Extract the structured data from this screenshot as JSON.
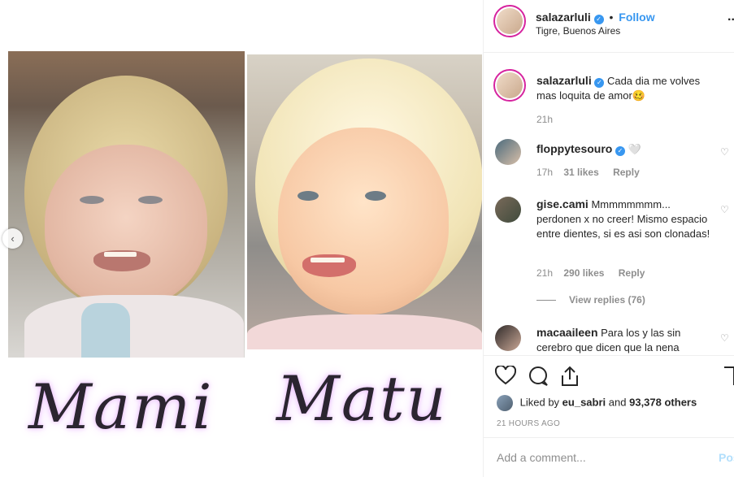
{
  "media": {
    "left_label": "Mami",
    "right_label": "Matu"
  },
  "header": {
    "username": "salazarluli",
    "separator": "•",
    "follow_label": "Follow",
    "location": "Tigre, Buenos Aires",
    "more_icon": "more-horizontal-icon",
    "more_glyph": "..."
  },
  "caption": {
    "username": "salazarluli",
    "text": "Cada dia me volves mas loquita de amor🥴",
    "time": "21h"
  },
  "comments": [
    {
      "username": "floppytesouro",
      "verified": true,
      "text": "🤍",
      "time": "17h",
      "likes": "31 likes",
      "reply_label": "Reply"
    },
    {
      "username": "gise.cami",
      "verified": false,
      "text": "Mmmmmmmm... perdonen x no creer! Mismo espacio entre dientes, si es asi son clonadas!",
      "time": "21h",
      "likes": "290 likes",
      "reply_label": "Reply",
      "view_replies": "View replies (76)"
    },
    {
      "username": "macaaileen",
      "verified": false,
      "text": "Para los y las sin cerebro que dicen que la nena"
    }
  ],
  "actions": {
    "liked_prefix": "Liked by",
    "liked_user": "eu_sabri",
    "liked_and": "and",
    "liked_count": "93,378 others",
    "timestamp": "21 HOURS AGO"
  },
  "add_comment": {
    "placeholder": "Add a comment...",
    "post_label": "Post"
  },
  "colors": {
    "accent": "#3897f0",
    "muted": "#8e8e8e",
    "text": "#262626",
    "story_ring": "#d6249f"
  }
}
